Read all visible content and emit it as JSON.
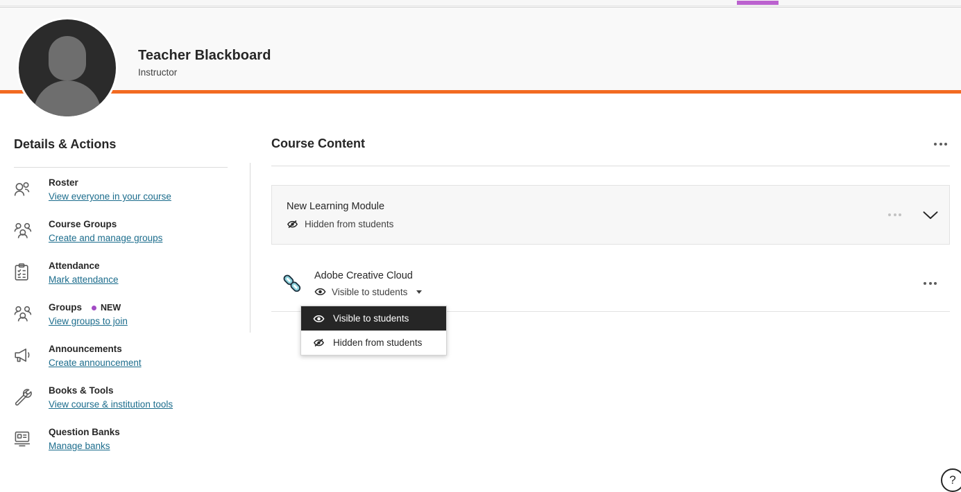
{
  "browser": {
    "tab_accent_color": "#bb62cf"
  },
  "profile": {
    "name": "Teacher Blackboard",
    "role": "Instructor",
    "avatar_alt": "user-avatar",
    "accent_rule_color": "#f26a21"
  },
  "sidebar": {
    "title": "Details & Actions",
    "items": [
      {
        "icon": "roster-icon",
        "label": "Roster",
        "link": "View everyone in your course",
        "badge": null
      },
      {
        "icon": "course-groups-icon",
        "label": "Course Groups",
        "link": "Create and manage groups",
        "badge": null
      },
      {
        "icon": "attendance-icon",
        "label": "Attendance",
        "link": "Mark attendance",
        "badge": null
      },
      {
        "icon": "groups-icon",
        "label": "Groups",
        "link": "View groups to join",
        "badge": "NEW"
      },
      {
        "icon": "announcements-icon",
        "label": "Announcements",
        "link": "Create announcement",
        "badge": null
      },
      {
        "icon": "books-tools-icon",
        "label": "Books & Tools",
        "link": "View course & institution tools",
        "badge": null
      },
      {
        "icon": "question-banks-icon",
        "label": "Question Banks",
        "link": "Manage banks",
        "badge": null
      }
    ],
    "badge_dot_color": "#a24bc4",
    "link_color": "#1b6c8c"
  },
  "course_content": {
    "title": "Course Content",
    "overflow_menu": "more-options",
    "module": {
      "title": "New Learning Module",
      "status": "Hidden from students",
      "status_icon": "eye-slash-icon",
      "overflow_menu": "more-options",
      "expand_control": "chevron-down-icon"
    },
    "link_item": {
      "icon": "link-chain-icon",
      "title": "Adobe Creative Cloud",
      "visibility_value": "Visible to students",
      "visibility_icon": "eye-icon",
      "caret": "caret-down-icon",
      "overflow_menu": "more-options"
    }
  },
  "visibility_dropdown": {
    "open": true,
    "options": [
      {
        "label": "Visible to students",
        "icon": "eye-icon",
        "selected": true
      },
      {
        "label": "Hidden from students",
        "icon": "eye-slash-icon",
        "selected": false
      }
    ],
    "selected_background": "#262626"
  },
  "help": {
    "label": "?",
    "name": "help-button"
  }
}
